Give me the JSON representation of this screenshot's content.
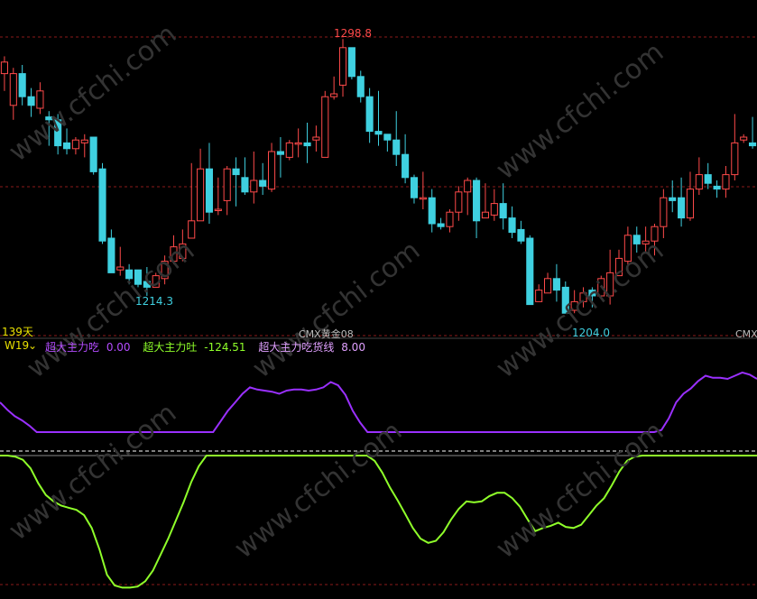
{
  "labels": {
    "price_high": "1298.8",
    "price_low_1": "1214.3",
    "price_low_2": "1204.0",
    "days": "139天",
    "contract_mid": "CMX黄金08",
    "contract_right": "CMX黄"
  },
  "indicator": {
    "name": "W19",
    "caret": "⌄",
    "items": [
      {
        "label": "超大主力吃",
        "value": "0.00",
        "color": "#b44cff"
      },
      {
        "label": "超大主力吐",
        "value": "-124.51",
        "color": "#8fff2a"
      },
      {
        "label": "超大主力吃货线",
        "value": "8.00",
        "color": "#e0a0ff"
      }
    ]
  },
  "watermark": {
    "text": "www.cfchi.com"
  },
  "colors": {
    "up": "#ff4a4a",
    "down": "#3fd0e0",
    "purple_line": "#9a30ff",
    "green_line": "#8fff2a",
    "grid": "#8b1a1a"
  },
  "candles": [
    [
      1287,
      1291,
      1281,
      1293
    ],
    [
      1276,
      1287,
      1271,
      1289
    ],
    [
      1287,
      1279,
      1276,
      1290
    ],
    [
      1279,
      1276,
      1272,
      1282
    ],
    [
      1275,
      1281,
      1273,
      1284
    ],
    [
      1272,
      1271,
      1262,
      1274
    ],
    [
      1271,
      1262,
      1259,
      1273
    ],
    [
      1263,
      1261,
      1259,
      1268
    ],
    [
      1261,
      1264,
      1259,
      1265
    ],
    [
      1263,
      1264,
      1258,
      1266
    ],
    [
      1265,
      1253,
      1252,
      1265
    ],
    [
      1254,
      1229,
      1228,
      1256
    ],
    [
      1230,
      1218,
      1218,
      1233
    ],
    [
      1219,
      1220,
      1217,
      1227
    ],
    [
      1219,
      1216,
      1214,
      1221
    ],
    [
      1219,
      1214,
      1213,
      1219
    ],
    [
      1215,
      1213,
      1210,
      1220
    ],
    [
      1213,
      1217,
      1213,
      1218
    ],
    [
      1216,
      1222,
      1214,
      1224
    ],
    [
      1222,
      1227,
      1221,
      1231
    ],
    [
      1223,
      1228,
      1222,
      1233
    ],
    [
      1230,
      1236,
      1230,
      1256
    ],
    [
      1236,
      1254,
      1236,
      1261
    ],
    [
      1254,
      1239,
      1235,
      1263
    ],
    [
      1240,
      1240,
      1238,
      1251
    ],
    [
      1243,
      1254,
      1238,
      1255
    ],
    [
      1254,
      1252,
      1241,
      1258
    ],
    [
      1251,
      1246,
      1245,
      1258
    ],
    [
      1246,
      1250,
      1242,
      1260
    ],
    [
      1250,
      1248,
      1245,
      1256
    ],
    [
      1247,
      1260,
      1246,
      1263
    ],
    [
      1260,
      1259,
      1251,
      1265
    ],
    [
      1258,
      1263,
      1257,
      1264
    ],
    [
      1263,
      1263,
      1258,
      1268
    ],
    [
      1263,
      1262,
      1256,
      1270
    ],
    [
      1264,
      1265,
      1260,
      1269
    ],
    [
      1258,
      1279,
      1258,
      1281
    ],
    [
      1279,
      1280,
      1278,
      1286
    ],
    [
      1283,
      1296,
      1279,
      1299
    ],
    [
      1296,
      1286,
      1285,
      1296
    ],
    [
      1286,
      1279,
      1277,
      1288
    ],
    [
      1279,
      1267,
      1263,
      1282
    ],
    [
      1267,
      1266,
      1262,
      1281
    ],
    [
      1266,
      1264,
      1260,
      1266
    ],
    [
      1264,
      1259,
      1255,
      1274
    ],
    [
      1259,
      1251,
      1249,
      1266
    ],
    [
      1251,
      1244,
      1242,
      1252
    ],
    [
      1244,
      1244,
      1240,
      1253
    ],
    [
      1244,
      1235,
      1232,
      1247
    ],
    [
      1235,
      1234,
      1233,
      1237
    ],
    [
      1234,
      1239,
      1232,
      1240
    ],
    [
      1239,
      1246,
      1236,
      1248
    ],
    [
      1246,
      1250,
      1238,
      1251
    ],
    [
      1250,
      1236,
      1230,
      1251
    ],
    [
      1237,
      1239,
      1237,
      1249
    ],
    [
      1238,
      1242,
      1236,
      1247
    ],
    [
      1242,
      1237,
      1233,
      1249
    ],
    [
      1237,
      1232,
      1230,
      1241
    ],
    [
      1233,
      1229,
      1228,
      1236
    ],
    [
      1230,
      1207,
      1207,
      1231
    ],
    [
      1208,
      1212,
      1208,
      1214
    ],
    [
      1211,
      1216,
      1211,
      1218
    ],
    [
      1216,
      1212,
      1208,
      1221
    ],
    [
      1213,
      1204,
      1204,
      1215
    ],
    [
      1205,
      1208,
      1204,
      1212
    ],
    [
      1208,
      1211,
      1206,
      1213
    ],
    [
      1212,
      1210,
      1206,
      1213
    ],
    [
      1210,
      1216,
      1209,
      1217
    ],
    [
      1210,
      1218,
      1207,
      1226
    ],
    [
      1217,
      1223,
      1217,
      1226
    ],
    [
      1222,
      1231,
      1218,
      1234
    ],
    [
      1231,
      1228,
      1225,
      1234
    ],
    [
      1228,
      1229,
      1225,
      1234
    ],
    [
      1229,
      1234,
      1224,
      1235
    ],
    [
      1234,
      1244,
      1230,
      1247
    ],
    [
      1244,
      1243,
      1239,
      1250
    ],
    [
      1244,
      1237,
      1234,
      1251
    ],
    [
      1237,
      1247,
      1236,
      1253
    ],
    [
      1247,
      1252,
      1245,
      1258
    ],
    [
      1252,
      1249,
      1247,
      1256
    ],
    [
      1248,
      1247,
      1244,
      1250
    ],
    [
      1247,
      1252,
      1244,
      1255
    ],
    [
      1252,
      1263,
      1250,
      1273
    ],
    [
      1264,
      1265,
      1263,
      1266
    ],
    [
      1263,
      1262,
      1261,
      1272
    ]
  ],
  "purple": [
    50,
    43,
    37,
    33,
    28,
    22,
    22,
    22,
    22,
    22,
    22,
    22,
    22,
    22,
    22,
    22,
    22,
    22,
    22,
    22,
    22,
    22,
    22,
    22,
    22,
    22,
    22,
    22,
    22,
    22,
    32,
    42,
    50,
    58,
    64,
    62,
    61,
    60,
    58,
    61,
    62,
    62,
    61,
    62,
    64,
    69,
    66,
    57,
    42,
    31,
    22,
    22,
    22,
    22,
    22,
    22,
    22,
    22,
    22,
    22,
    22,
    22,
    22,
    22,
    22,
    22,
    22,
    22,
    22,
    22,
    22,
    22,
    22,
    22,
    22,
    22,
    22,
    22,
    22,
    22,
    22,
    22,
    22,
    22,
    22,
    22,
    22,
    22,
    22,
    22,
    24,
    35,
    50,
    58,
    63,
    70,
    75,
    73,
    73,
    72,
    75,
    78,
    76,
    72
  ],
  "green": [
    0,
    0,
    -1,
    -4,
    -12,
    -26,
    -37,
    -43,
    -47,
    -49,
    -51,
    -56,
    -68,
    -88,
    -112,
    -122,
    -124,
    -124,
    -123,
    -118,
    -108,
    -93,
    -78,
    -61,
    -44,
    -25,
    -10,
    0,
    0,
    0,
    0,
    0,
    0,
    0,
    0,
    0,
    0,
    0,
    0,
    0,
    0,
    0,
    0,
    0,
    0,
    0,
    0,
    0,
    0,
    -5,
    -16,
    -30,
    -42,
    -55,
    -68,
    -78,
    -82,
    -80,
    -72,
    -60,
    -50,
    -43,
    -44,
    -43,
    -38,
    -35,
    -35,
    -40,
    -48,
    -60,
    -71,
    -68,
    -66,
    -63,
    -67,
    -68,
    -65,
    -56,
    -47,
    -40,
    -28,
    -15,
    -5,
    -1,
    0,
    0,
    0,
    0,
    0,
    0,
    0,
    0,
    0,
    0,
    0,
    0,
    0,
    0,
    0,
    0
  ]
}
